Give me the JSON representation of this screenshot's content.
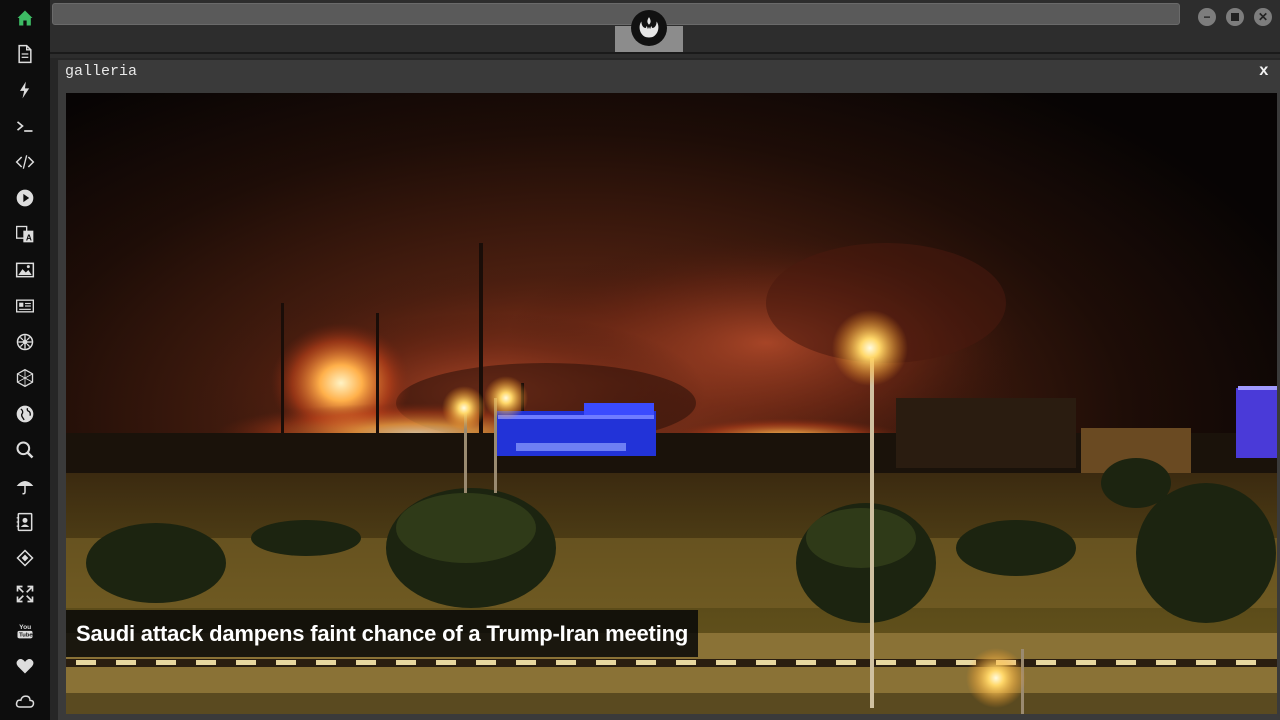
{
  "sidebar": {
    "items": [
      {
        "icon": "home-icon",
        "active": true
      },
      {
        "icon": "document-icon"
      },
      {
        "icon": "lightning-icon"
      },
      {
        "icon": "terminal-icon"
      },
      {
        "icon": "code-icon"
      },
      {
        "icon": "play-icon"
      },
      {
        "icon": "translate-icon"
      },
      {
        "icon": "image-icon"
      },
      {
        "icon": "news-icon"
      },
      {
        "icon": "settings-icon"
      },
      {
        "icon": "network-icon"
      },
      {
        "icon": "globe-icon"
      },
      {
        "icon": "search-icon"
      },
      {
        "icon": "umbrella-icon"
      },
      {
        "icon": "contact-icon"
      },
      {
        "icon": "transfer-icon"
      },
      {
        "icon": "fullscreen-icon"
      },
      {
        "icon": "youtube-icon"
      },
      {
        "icon": "heart-icon"
      },
      {
        "icon": "cloud-icon"
      }
    ]
  },
  "topbar": {
    "logo_icon": "rebel-alliance-icon",
    "window_controls": [
      "minimize-icon",
      "maximize-icon",
      "close-icon"
    ]
  },
  "panel": {
    "title": "galleria",
    "close_label": "x"
  },
  "gallery": {
    "caption": "Saudi attack dampens faint chance of a Trump-Iran meeting"
  },
  "colors": {
    "accent_active": "#3dbb64",
    "sidebar_bg": "#0d0d0d",
    "panel_bg": "#3a3a3a"
  }
}
